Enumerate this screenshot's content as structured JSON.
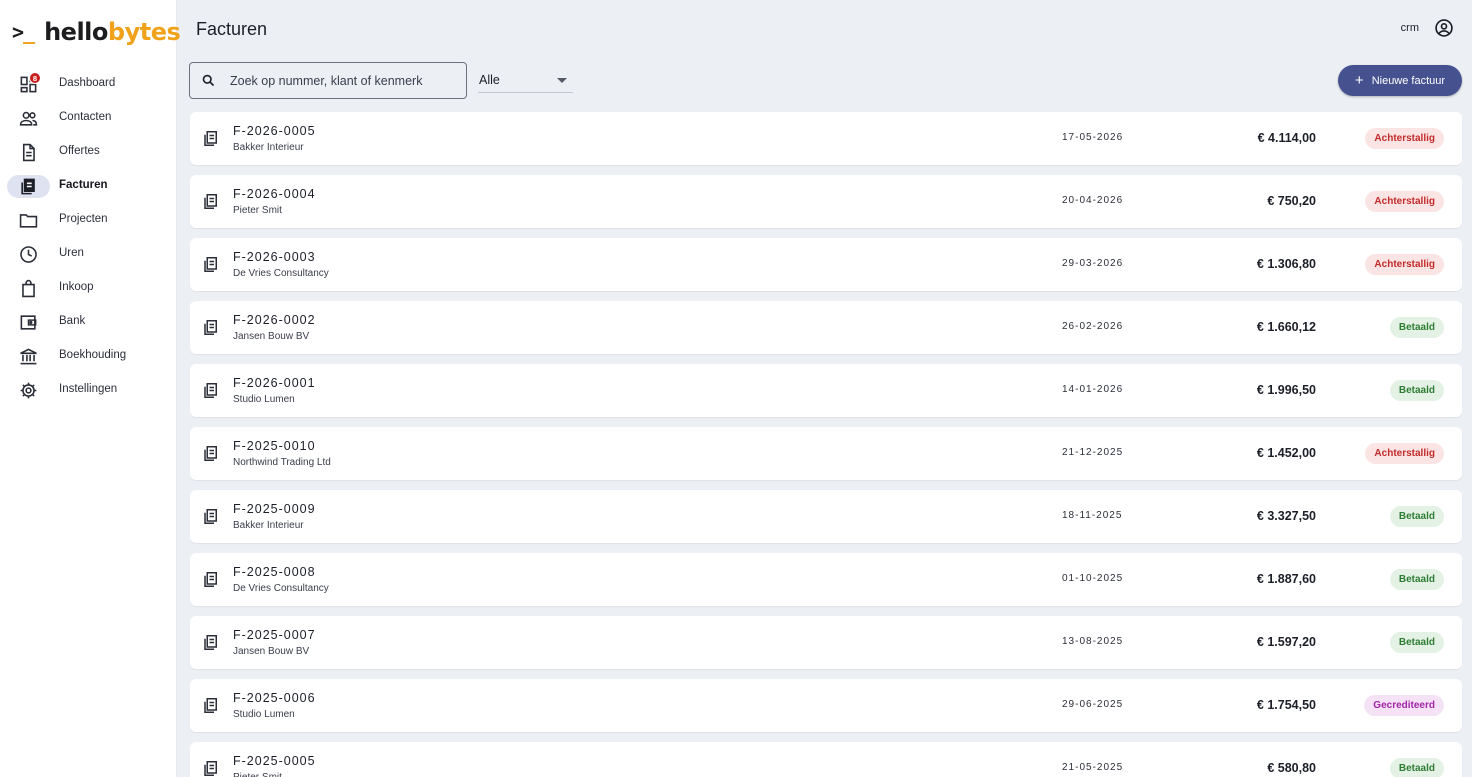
{
  "brand": {
    "prompt": ">",
    "prompt_underscore": "_",
    "name_part1": "hello",
    "name_part2": "bytes",
    "accent_color": "#f0a21b"
  },
  "sidebar": {
    "items": [
      {
        "label": "Dashboard",
        "icon": "dashboard-icon",
        "badge": "8",
        "active": false
      },
      {
        "label": "Contacten",
        "icon": "people-icon",
        "active": false
      },
      {
        "label": "Offertes",
        "icon": "document-icon",
        "active": false
      },
      {
        "label": "Facturen",
        "icon": "receipt-icon",
        "active": true
      },
      {
        "label": "Projecten",
        "icon": "folder-icon",
        "active": false
      },
      {
        "label": "Uren",
        "icon": "clock-icon",
        "active": false
      },
      {
        "label": "Inkoop",
        "icon": "shopping-bag-icon",
        "active": false
      },
      {
        "label": "Bank",
        "icon": "wallet-icon",
        "active": false
      },
      {
        "label": "Boekhouding",
        "icon": "bank-icon",
        "active": false
      },
      {
        "label": "Instellingen",
        "icon": "gear-icon",
        "active": false
      }
    ]
  },
  "header": {
    "title": "Facturen",
    "user": "crm"
  },
  "toolbar": {
    "search_placeholder": "Zoek op nummer, klant of kenmerk",
    "filter_value": "Alle",
    "new_button_label": "Nieuwe factuur",
    "primary_color": "#465290"
  },
  "status_colors": {
    "Achterstallig": "#c42b2b",
    "Betaald": "#2f7d35",
    "Gecrediteerd": "#a026a6"
  },
  "invoices": [
    {
      "number": "F-2026-0005",
      "client": "Bakker Interieur",
      "date": "17-05-2026",
      "amount": "€ 4.114,00",
      "status": "Achterstallig",
      "kind": "over"
    },
    {
      "number": "F-2026-0004",
      "client": "Pieter Smit",
      "date": "20-04-2026",
      "amount": "€ 750,20",
      "status": "Achterstallig",
      "kind": "over"
    },
    {
      "number": "F-2026-0003",
      "client": "De Vries Consultancy",
      "date": "29-03-2026",
      "amount": "€ 1.306,80",
      "status": "Achterstallig",
      "kind": "over"
    },
    {
      "number": "F-2026-0002",
      "client": "Jansen Bouw BV",
      "date": "26-02-2026",
      "amount": "€ 1.660,12",
      "status": "Betaald",
      "kind": "paid"
    },
    {
      "number": "F-2026-0001",
      "client": "Studio Lumen",
      "date": "14-01-2026",
      "amount": "€ 1.996,50",
      "status": "Betaald",
      "kind": "paid"
    },
    {
      "number": "F-2025-0010",
      "client": "Northwind Trading Ltd",
      "date": "21-12-2025",
      "amount": "€ 1.452,00",
      "status": "Achterstallig",
      "kind": "over"
    },
    {
      "number": "F-2025-0009",
      "client": "Bakker Interieur",
      "date": "18-11-2025",
      "amount": "€ 3.327,50",
      "status": "Betaald",
      "kind": "paid"
    },
    {
      "number": "F-2025-0008",
      "client": "De Vries Consultancy",
      "date": "01-10-2025",
      "amount": "€ 1.887,60",
      "status": "Betaald",
      "kind": "paid"
    },
    {
      "number": "F-2025-0007",
      "client": "Jansen Bouw BV",
      "date": "13-08-2025",
      "amount": "€ 1.597,20",
      "status": "Betaald",
      "kind": "paid"
    },
    {
      "number": "F-2025-0006",
      "client": "Studio Lumen",
      "date": "29-06-2025",
      "amount": "€ 1.754,50",
      "status": "Gecrediteerd",
      "kind": "cred"
    },
    {
      "number": "F-2025-0005",
      "client": "Pieter Smit",
      "date": "21-05-2025",
      "amount": "€ 580,80",
      "status": "Betaald",
      "kind": "paid"
    }
  ]
}
